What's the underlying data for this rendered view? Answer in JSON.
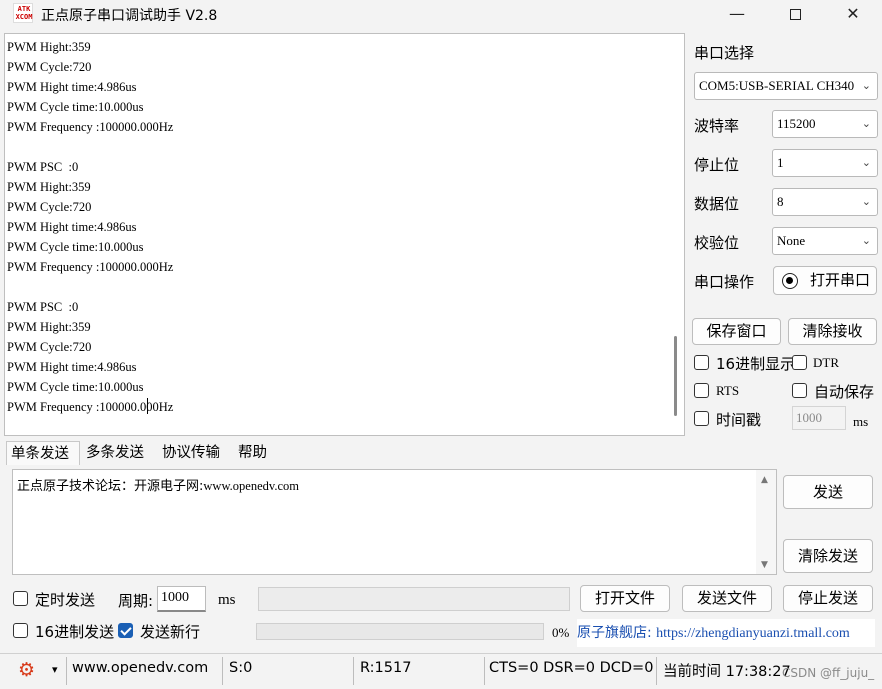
{
  "window": {
    "logo_line1": "ATK",
    "logo_line2": "XCOM",
    "title": "正点原子串口调试助手 V2.8",
    "minimize_glyph": "—",
    "close_glyph": "✕"
  },
  "receive": {
    "lines": [
      "PWM Hight:359",
      "PWM Cycle:720",
      "PWM Hight time:4.986us",
      "PWM Cycle time:10.000us",
      "PWM Frequency :100000.000Hz",
      "",
      "PWM PSC  :0",
      "PWM Hight:359",
      "PWM Cycle:720",
      "PWM Hight time:4.986us",
      "PWM Cycle time:10.000us",
      "PWM Frequency :100000.000Hz",
      "",
      "PWM PSC  :0",
      "PWM Hight:359",
      "PWM Cycle:720",
      "PWM Hight time:4.986us",
      "PWM Cycle time:10.000us",
      "PWM Frequency :100000.000Hz"
    ]
  },
  "serial": {
    "select_label": "串口选择",
    "port_value": "COM5:USB-SERIAL CH340",
    "baud_label": "波特率",
    "baud_value": "115200",
    "stop_label": "停止位",
    "stop_value": "1",
    "data_label": "数据位",
    "data_value": "8",
    "parity_label": "校验位",
    "parity_value": "None",
    "op_label": "串口操作",
    "open_button": "打开串口",
    "save_window": "保存窗口",
    "clear_receive": "清除接收",
    "hex_display": "16进制显示",
    "dtr": "DTR",
    "rts": "RTS",
    "auto_save": "自动保存",
    "timestamp": "时间戳",
    "timestamp_value": "1000",
    "timestamp_unit": "ms"
  },
  "tabs": [
    "单条发送",
    "多条发送",
    "协议传输",
    "帮助"
  ],
  "send": {
    "text_prefix": "正点原子技术论坛：开源电子网:",
    "text_url": "www.openedv.com",
    "send_button": "发送",
    "clear_send_button": "清除发送",
    "timed_send": "定时发送",
    "period_label": "周期:",
    "period_value": "1000",
    "period_unit": "ms",
    "open_file": "打开文件",
    "send_file": "发送文件",
    "stop_send": "停止发送",
    "hex_send": "16进制发送",
    "send_newline": "发送新行",
    "progress_percent": "0%",
    "link_text": "原子旗舰店:",
    "link_url": "https://zhengdianyuanzi.tmall.com"
  },
  "status": {
    "website": "www.openedv.com",
    "sent": "S:0",
    "received": "R:1517",
    "lines": "CTS=0 DSR=0 DCD=0",
    "time": "当前时间 17:38:27",
    "watermark": "CSDN @ff_juju_"
  },
  "colors": {
    "accent": "#1a5fb4",
    "gear": "#d83a1a",
    "link": "#1a4fb0"
  }
}
